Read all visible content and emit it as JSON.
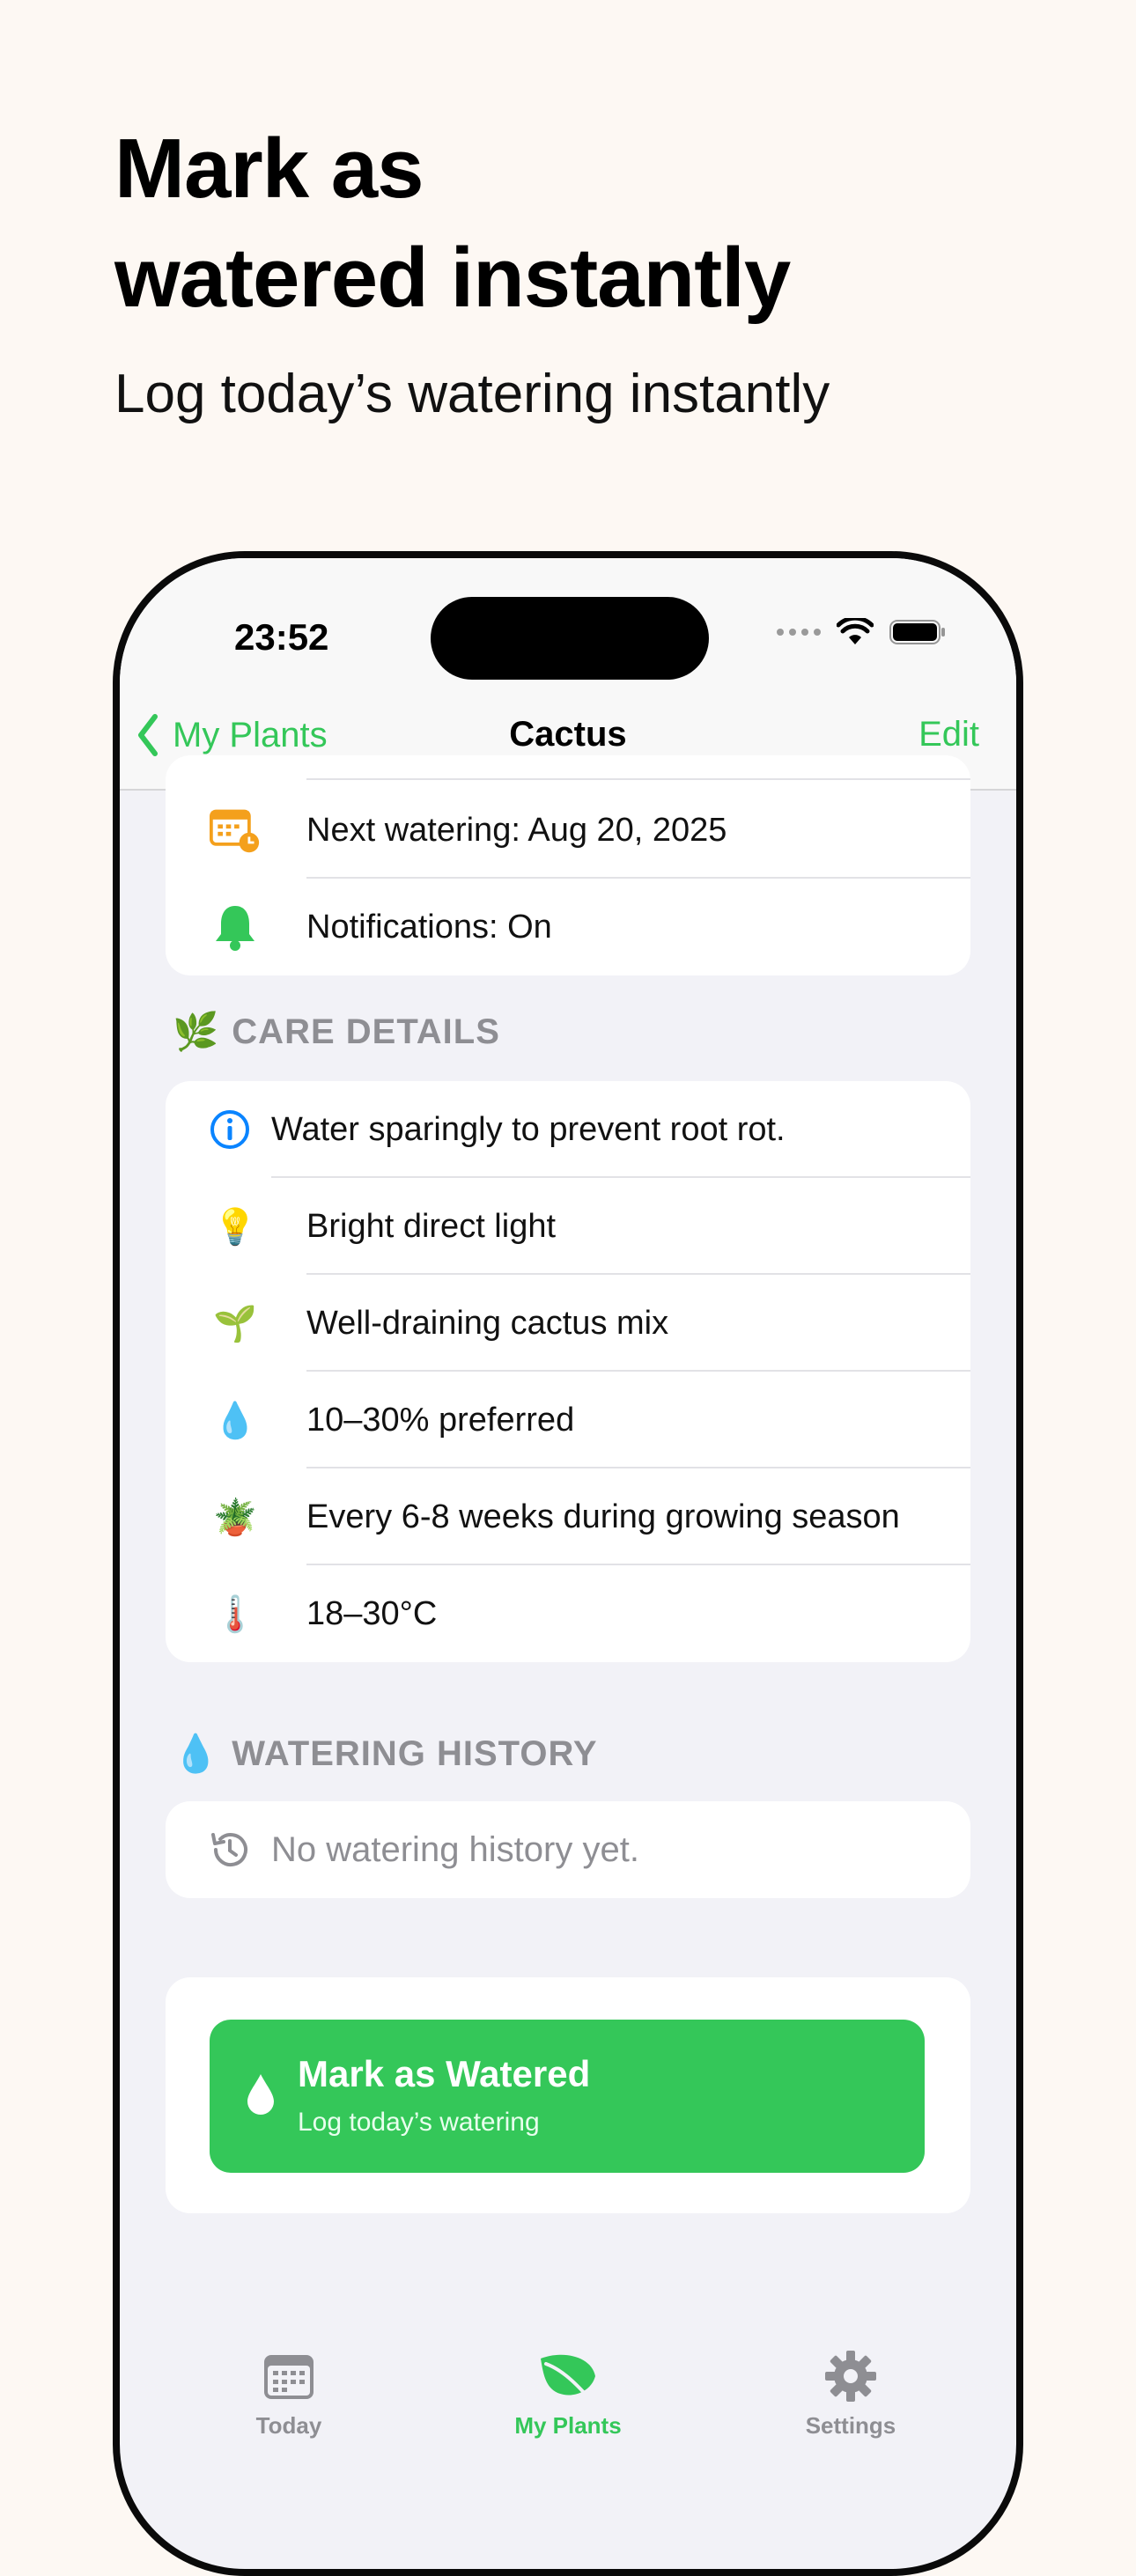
{
  "promo": {
    "headline_line1": "Mark as",
    "headline_line2": "watered instantly",
    "subhead": "Log today’s watering instantly"
  },
  "status_bar": {
    "time": "23:52"
  },
  "nav": {
    "back_label": "My Plants",
    "title": "Cactus",
    "edit_label": "Edit"
  },
  "schedule": {
    "rows": [
      {
        "icon": "calendar-clock-icon",
        "text": "Next watering: Aug 20, 2025"
      },
      {
        "icon": "bell-icon",
        "text": "Notifications: On"
      }
    ]
  },
  "care_details": {
    "title": "CARE DETAILS",
    "title_icon": "herb-icon",
    "note": "Water sparingly to prevent root rot.",
    "rows": [
      {
        "icon": "light-bulb-icon",
        "text": "Bright direct light"
      },
      {
        "icon": "seedling-icon",
        "text": "Well-draining cactus mix"
      },
      {
        "icon": "droplet-icon",
        "text": "10–30% preferred"
      },
      {
        "icon": "potted-plant-icon",
        "text": "Every 6-8 weeks during growing season"
      },
      {
        "icon": "thermometer-icon",
        "text": "18–30°C"
      }
    ]
  },
  "watering_history": {
    "title": "WATERING HISTORY",
    "title_icon": "droplet-icon",
    "empty_text": "No watering history yet."
  },
  "action": {
    "label": "Mark as Watered",
    "sublabel": "Log today’s watering"
  },
  "tabs": [
    {
      "label": "Today",
      "icon": "calendar-icon",
      "active": false
    },
    {
      "label": "My Plants",
      "icon": "leaf-icon",
      "active": true
    },
    {
      "label": "Settings",
      "icon": "gear-icon",
      "active": false
    }
  ],
  "colors": {
    "accent": "#34C759",
    "background": "#FDF8F3",
    "screen_background": "#F2F2F7",
    "secondary_text": "#8E8E93"
  }
}
